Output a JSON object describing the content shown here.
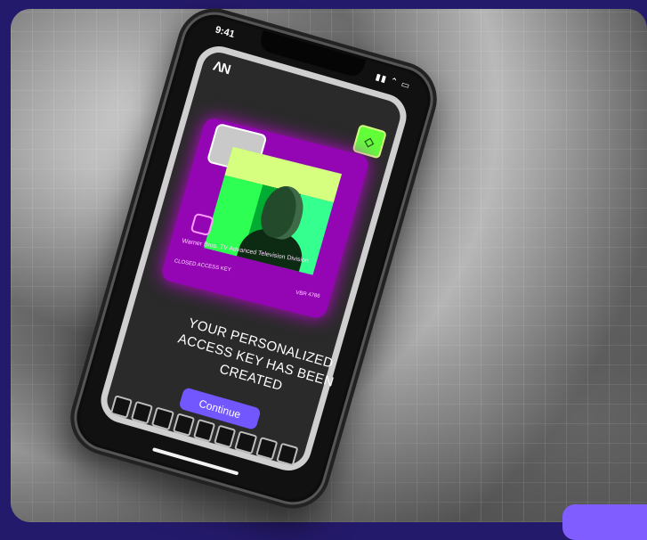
{
  "phone": {
    "time": "9:41",
    "logo": "ΛN",
    "message": "YOUR PERSONALIZED ACCESS KEY HAS BEEN CREATED",
    "continue_label": "Continue",
    "card": {
      "tab_logo": "ΛN",
      "title": "Warner Bros. TV Advanced Television Division",
      "subtitle": "CLOSED ACCESS KEY",
      "code": "VBR 4786"
    }
  },
  "colors": {
    "background": "#241a6b",
    "card": "#a700cc",
    "accent_green": "#62ff39",
    "button": "#7257ff"
  }
}
